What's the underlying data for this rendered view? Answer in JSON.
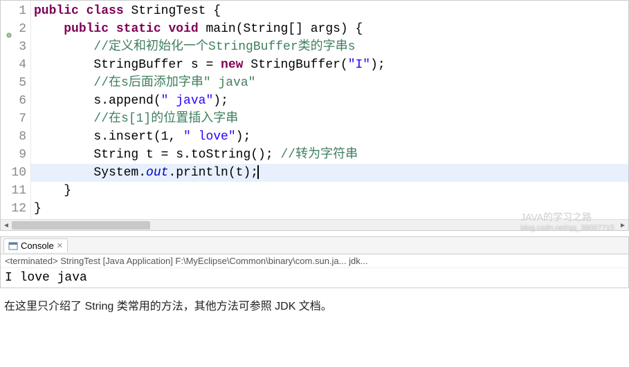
{
  "editor": {
    "lines": [
      {
        "n": "1",
        "tokens": [
          {
            "t": "public ",
            "c": "kw"
          },
          {
            "t": "class ",
            "c": "kw"
          },
          {
            "t": "StringTest {",
            "c": ""
          }
        ]
      },
      {
        "n": "2",
        "marker": "collapse",
        "tokens": [
          {
            "t": "    ",
            "c": ""
          },
          {
            "t": "public ",
            "c": "kw"
          },
          {
            "t": "static ",
            "c": "kw"
          },
          {
            "t": "void ",
            "c": "kw"
          },
          {
            "t": "main(String[] args) {",
            "c": ""
          }
        ]
      },
      {
        "n": "3",
        "tokens": [
          {
            "t": "        ",
            "c": ""
          },
          {
            "t": "//定义和初始化一个StringBuffer类的字串s",
            "c": "cm"
          }
        ]
      },
      {
        "n": "4",
        "tokens": [
          {
            "t": "        StringBuffer s = ",
            "c": ""
          },
          {
            "t": "new ",
            "c": "kw"
          },
          {
            "t": "StringBuffer(",
            "c": ""
          },
          {
            "t": "\"I\"",
            "c": "str"
          },
          {
            "t": ");",
            "c": ""
          }
        ]
      },
      {
        "n": "5",
        "tokens": [
          {
            "t": "        ",
            "c": ""
          },
          {
            "t": "//在s后面添加字串\" java\"",
            "c": "cm"
          }
        ]
      },
      {
        "n": "6",
        "tokens": [
          {
            "t": "        s.append(",
            "c": ""
          },
          {
            "t": "\" java\"",
            "c": "str"
          },
          {
            "t": ");",
            "c": ""
          }
        ]
      },
      {
        "n": "7",
        "tokens": [
          {
            "t": "        ",
            "c": ""
          },
          {
            "t": "//在s[1]的位置插入字串",
            "c": "cm"
          }
        ]
      },
      {
        "n": "8",
        "tokens": [
          {
            "t": "        s.insert(1, ",
            "c": ""
          },
          {
            "t": "\" love\"",
            "c": "str"
          },
          {
            "t": ");",
            "c": ""
          }
        ]
      },
      {
        "n": "9",
        "tokens": [
          {
            "t": "        String t = s.toString(); ",
            "c": ""
          },
          {
            "t": "//转为字符串",
            "c": "cm"
          }
        ]
      },
      {
        "n": "10",
        "hl": true,
        "tokens": [
          {
            "t": "        System.",
            "c": ""
          },
          {
            "t": "out",
            "c": "fld"
          },
          {
            "t": ".println(t);",
            "c": ""
          },
          {
            "t": "|",
            "c": "cursor"
          }
        ]
      },
      {
        "n": "11",
        "tokens": [
          {
            "t": "    }",
            "c": ""
          }
        ]
      },
      {
        "n": "12",
        "tokens": [
          {
            "t": "}",
            "c": ""
          }
        ]
      }
    ]
  },
  "console": {
    "tab_label": "Console",
    "status": "<terminated> StringTest [Java Application] F:\\MyEclipse\\Common\\binary\\com.sun.ja... jdk...",
    "output": "I love java"
  },
  "watermark": "JAVA的学习之路",
  "watermark_sub": "blog.csdn.net/qq_38007715",
  "footer": "在这里只介绍了 String 类常用的方法，其他方法可参照 JDK 文档。"
}
